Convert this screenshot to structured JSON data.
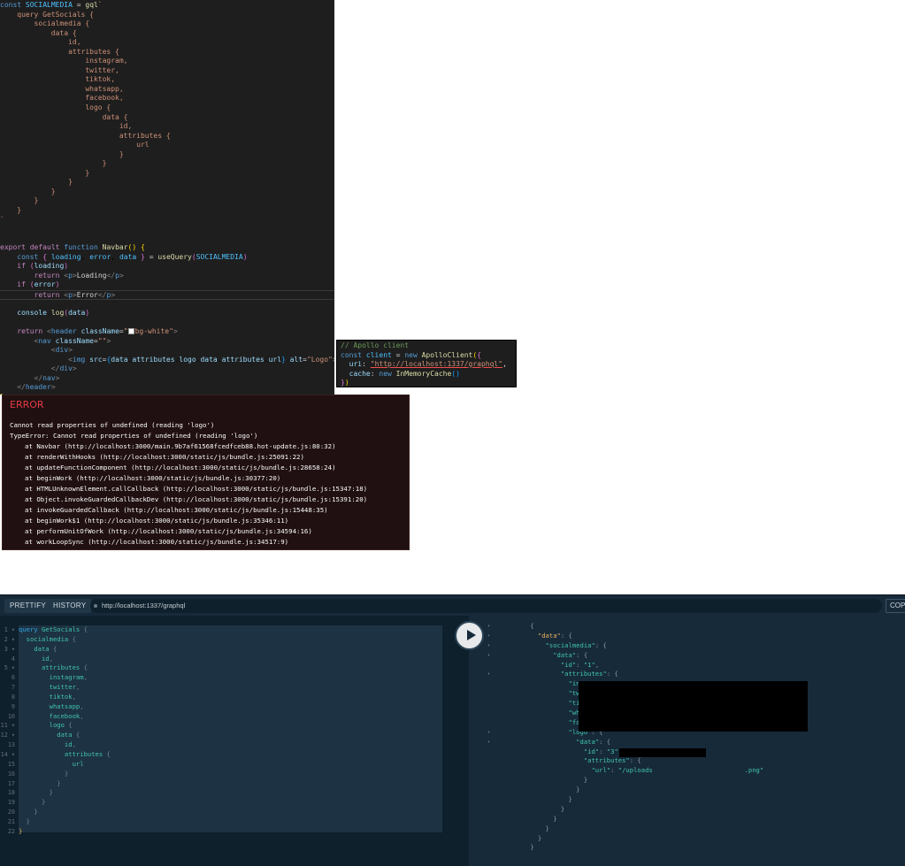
{
  "code_editor": {
    "lines": [
      "const SOCIALMEDIA = gql`",
      "    query GetSocials {",
      "        socialmedia {",
      "            data {",
      "                id,",
      "                attributes {",
      "                    instagram,",
      "                    twitter,",
      "                    tiktok,",
      "                    whatsapp,",
      "                    facebook,",
      "                    logo {",
      "                        data {",
      "                            id,",
      "                            attributes {",
      "                                url",
      "                            }",
      "                        }",
      "                    }",
      "                }",
      "            }",
      "        }",
      "    }",
      "`",
      "",
      "",
      "export default function Navbar() {",
      "    const { loading, error, data } = useQuery(SOCIALMEDIA)",
      "    if (loading)",
      "        return <p>Loading</p>",
      "    if (error)",
      "        return <p>Error</p>",
      "",
      "    console.log(data)",
      "",
      "    return <header className=\"bg-white\">",
      "        <nav className=\"\">",
      "            <div>",
      "                <img src={data.attributes.logo.data.attributes.url} alt=\"Logo\"></img>",
      "            </div>",
      "        </nav>",
      "    </header>",
      "}"
    ]
  },
  "apollo_snippet": {
    "lines": [
      "// Apollo client",
      "const client = new ApolloClient({",
      "  uri: \"http://localhost:1337/graphql\",",
      "  cache: new InMemoryCache()",
      "})"
    ]
  },
  "error_overlay": {
    "title": "ERROR",
    "message": "Cannot read properties of undefined (reading 'logo')",
    "type_error": "TypeError: Cannot read properties of undefined (reading 'logo')",
    "stack": [
      "at Navbar (http://localhost:3000/main.9b7af61568fcedfceb88.hot-update.js:80:32)",
      "at renderWithHooks (http://localhost:3000/static/js/bundle.js:25091:22)",
      "at updateFunctionComponent (http://localhost:3000/static/js/bundle.js:28658:24)",
      "at beginWork (http://localhost:3000/static/js/bundle.js:30377:20)",
      "at HTMLUnknownElement.callCallback (http://localhost:3000/static/js/bundle.js:15347:18)",
      "at Object.invokeGuardedCallbackDev (http://localhost:3000/static/js/bundle.js:15391:20)",
      "at invokeGuardedCallback (http://localhost:3000/static/js/bundle.js:15448:35)",
      "at beginWork$1 (http://localhost:3000/static/js/bundle.js:35346:11)",
      "at performUnitOfWork (http://localhost:3000/static/js/bundle.js:34594:16)",
      "at workLoopSync (http://localhost:3000/static/js/bundle.js:34517:9)"
    ]
  },
  "playground": {
    "prettify_label": "PRETTIFY",
    "history_label": "HISTORY",
    "endpoint": "http://localhost:1337/graphql",
    "copy_label": "COP",
    "query_lines": [
      "query GetSocials {",
      "  socialmedia {",
      "    data {",
      "      id,",
      "      attributes {",
      "        instagram,",
      "        twitter,",
      "        tiktok,",
      "        whatsapp,",
      "        facebook,",
      "        logo {",
      "          data {",
      "            id,",
      "            attributes {",
      "              url",
      "            }",
      "          }",
      "        }",
      "      }",
      "    }",
      "  }",
      "}"
    ],
    "result_lines": [
      "{",
      "  \"data\": {",
      "    \"socialmedia\": {",
      "      \"data\": {",
      "        \"id\": \"1\",",
      "        \"attributes\": {",
      "          \"instagram\": ",
      "          \"twitter\": \"h",
      "          \"tiktok\": \"h",
      "          \"whatsapp\": ",
      "          \"facebook\": ",
      "          \"logo\": {",
      "            \"data\": {",
      "              \"id\": \"3\",",
      "              \"attributes\": {",
      "                \"url\": \"/uploads                    .png\"",
      "              }",
      "            }",
      "          }",
      "        }",
      "      }",
      "    }",
      "  }",
      "}"
    ]
  }
}
